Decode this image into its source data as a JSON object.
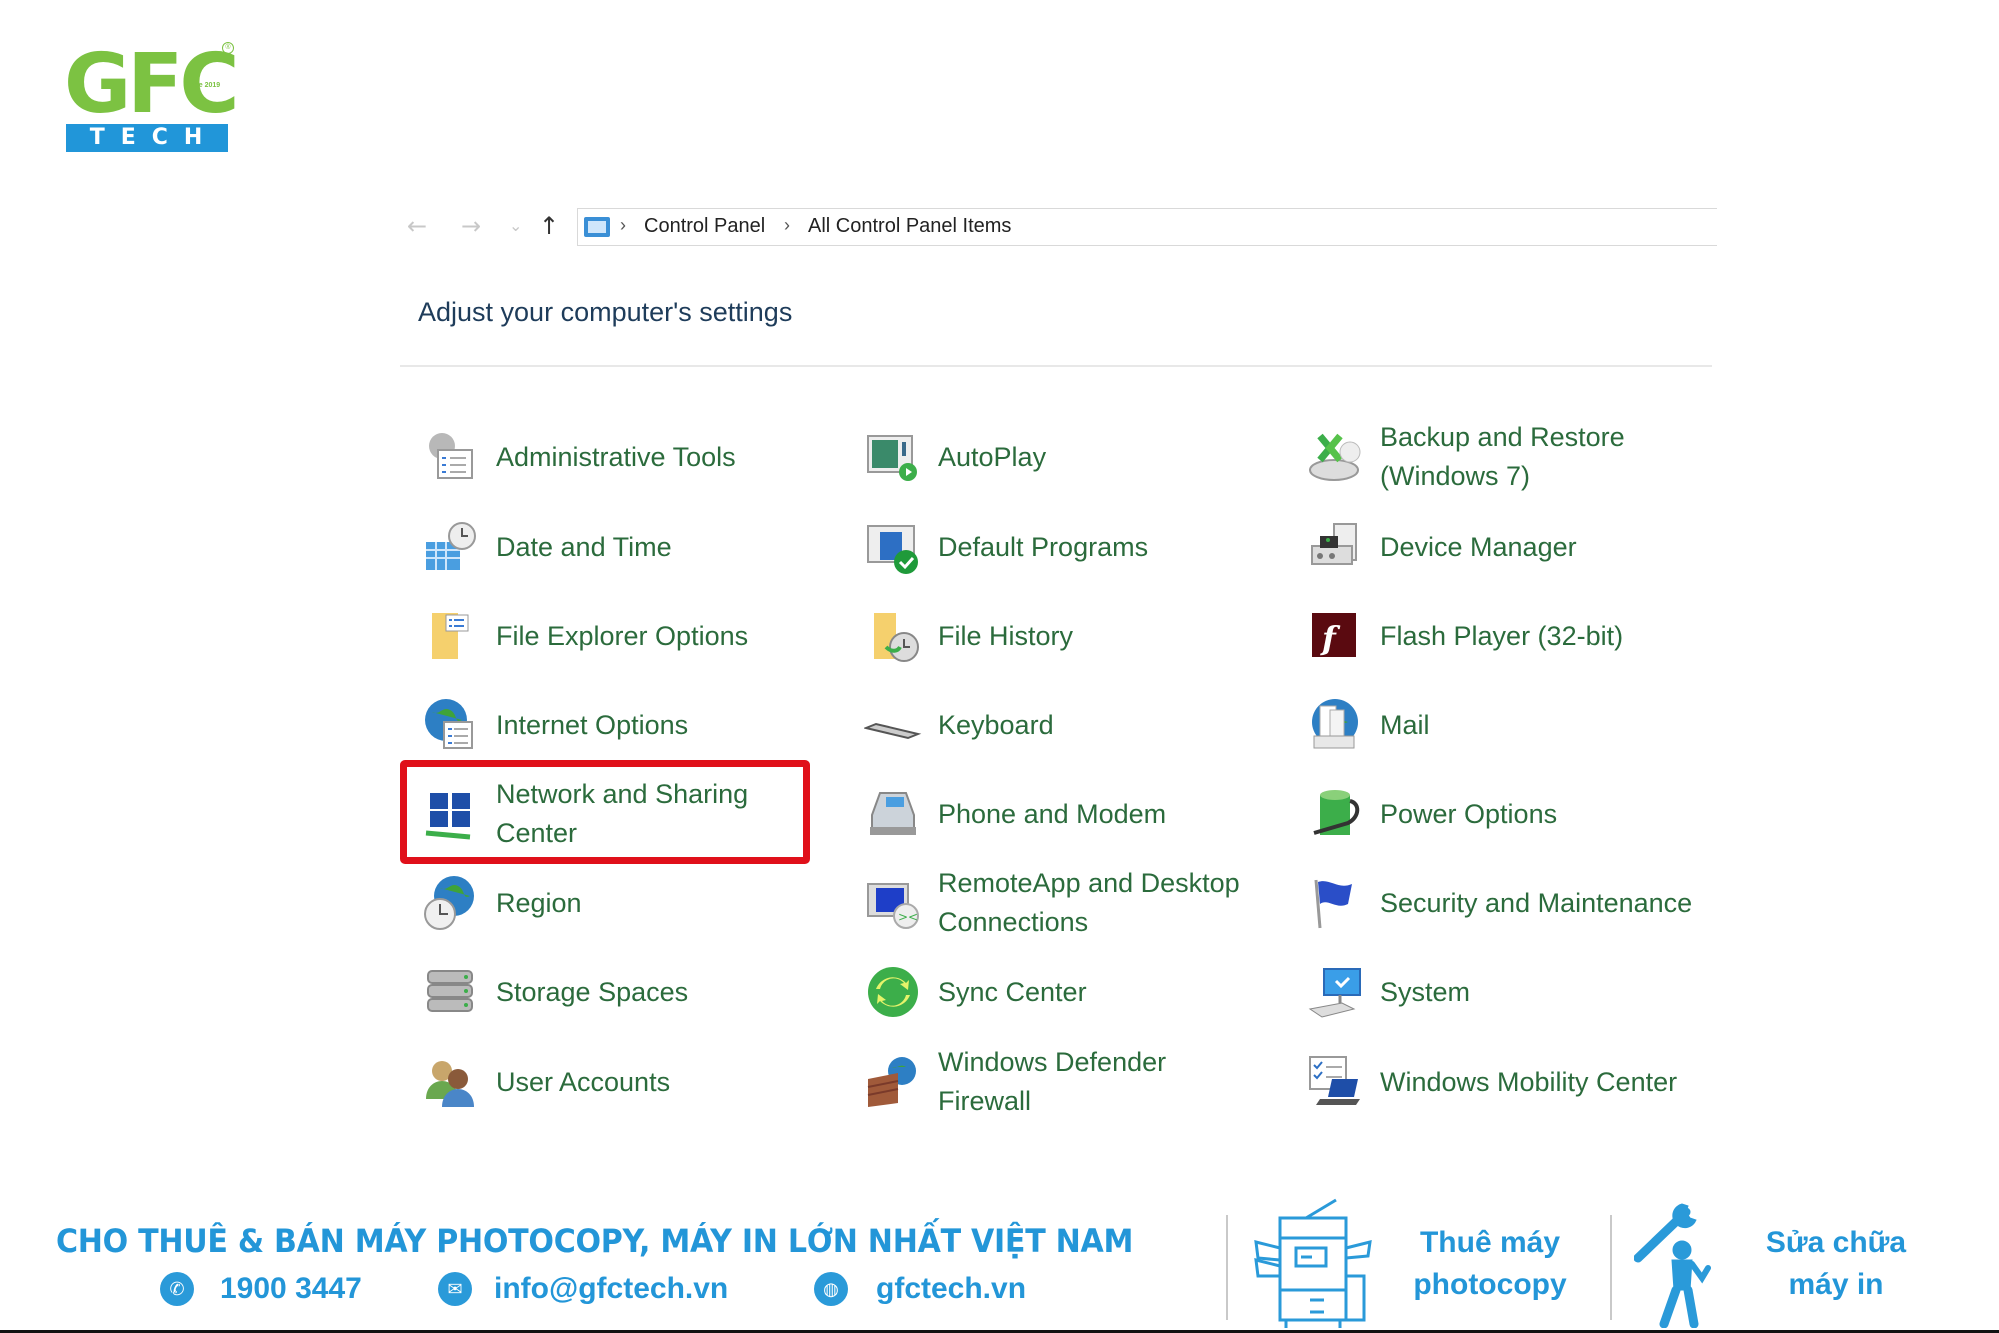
{
  "brand": {
    "logo_text": "GFC",
    "logo_sub": "TECH",
    "logo_since": "Since 2019",
    "logo_reg": "®",
    "colors": {
      "green": "#7cc242",
      "blue": "#2396d8",
      "highlight": "#e0101a",
      "link": "#2b6b3c"
    }
  },
  "nav": {
    "back_icon": "←",
    "forward_icon": "→",
    "recent_icon": "⌄",
    "up_icon": "↑",
    "breadcrumb": [
      "Control Panel",
      "All Control Panel Items"
    ],
    "separator": "›"
  },
  "heading": "Adjust your computer's settings",
  "columns": [
    [
      {
        "label": "Administrative Tools",
        "icon": "admin-tools-icon"
      },
      {
        "label": "Date and Time",
        "icon": "date-time-icon"
      },
      {
        "label": "File Explorer Options",
        "icon": "folder-options-icon"
      },
      {
        "label": "Internet Options",
        "icon": "internet-options-icon"
      },
      {
        "label": "Network and Sharing\nCenter",
        "icon": "network-icon",
        "highlighted": true
      },
      {
        "label": "Region",
        "icon": "region-icon"
      },
      {
        "label": "Storage Spaces",
        "icon": "storage-icon"
      },
      {
        "label": "User Accounts",
        "icon": "users-icon"
      }
    ],
    [
      {
        "label": "AutoPlay",
        "icon": "autoplay-icon"
      },
      {
        "label": "Default Programs",
        "icon": "default-programs-icon"
      },
      {
        "label": "File History",
        "icon": "file-history-icon"
      },
      {
        "label": "Keyboard",
        "icon": "keyboard-icon"
      },
      {
        "label": "Phone and Modem",
        "icon": "phone-icon"
      },
      {
        "label": "RemoteApp and Desktop\nConnections",
        "icon": "remoteapp-icon"
      },
      {
        "label": "Sync Center",
        "icon": "sync-icon"
      },
      {
        "label": "Windows Defender\nFirewall",
        "icon": "firewall-icon"
      }
    ],
    [
      {
        "label": "Backup and Restore\n(Windows 7)",
        "icon": "backup-icon"
      },
      {
        "label": "Device Manager",
        "icon": "device-manager-icon"
      },
      {
        "label": "Flash Player (32-bit)",
        "icon": "flash-icon"
      },
      {
        "label": "Mail",
        "icon": "mail-icon"
      },
      {
        "label": "Power Options",
        "icon": "power-icon"
      },
      {
        "label": "Security and Maintenance",
        "icon": "flag-icon"
      },
      {
        "label": "System",
        "icon": "system-icon"
      },
      {
        "label": "Windows Mobility Center",
        "icon": "mobility-icon"
      }
    ]
  ],
  "footer": {
    "title": "CHO THUÊ & BÁN MÁY PHOTOCOPY, MÁY IN LỚN NHẤT VIỆT NAM",
    "phone": "1900 3447",
    "email": "info@gfctech.vn",
    "website": "gfctech.vn",
    "promo1": "Thuê máy\nphotocopy",
    "promo2": "Sửa chữa\nmáy in"
  }
}
